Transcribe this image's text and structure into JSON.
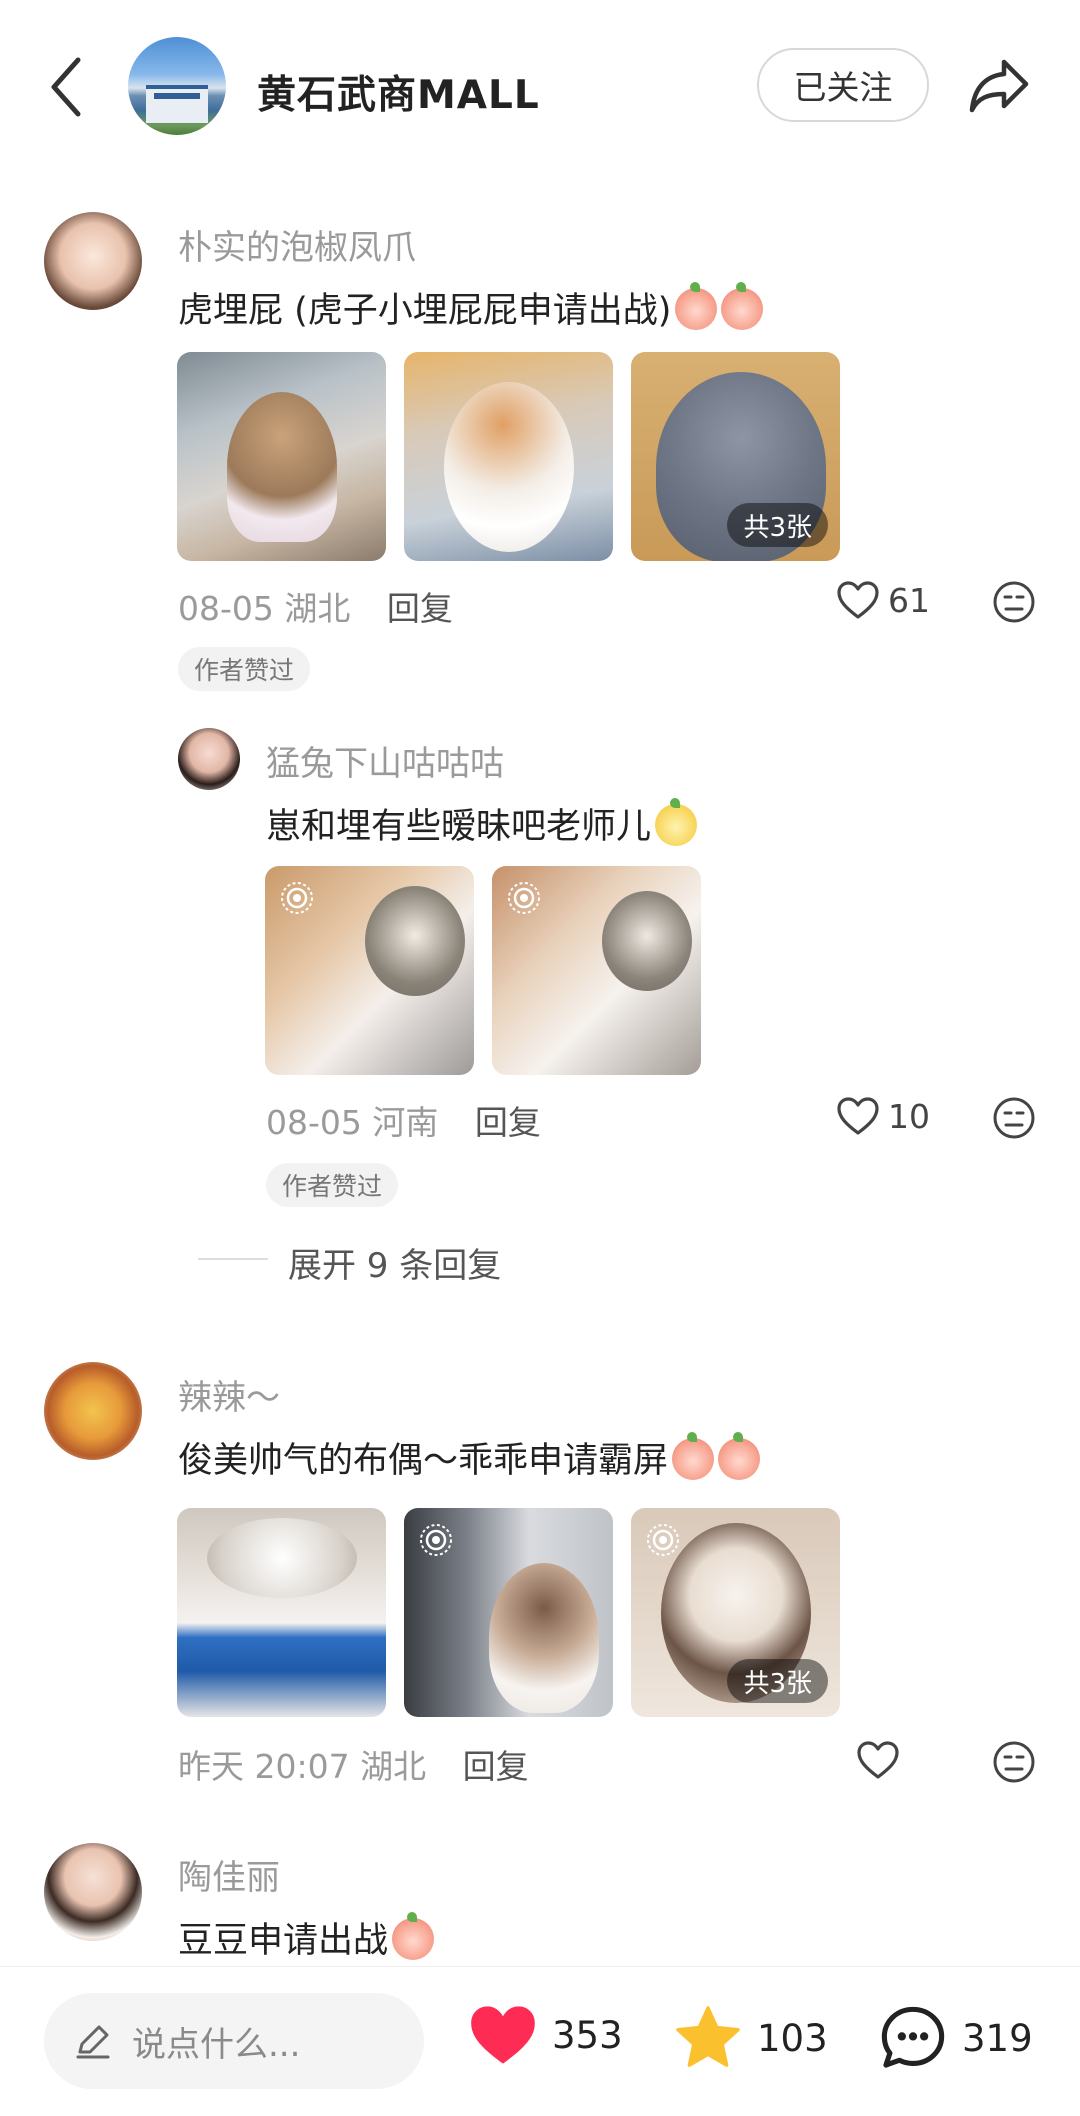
{
  "header": {
    "back_icon": "chevron-left-icon",
    "shop_name": "黄石武商MALL",
    "follow_label": "已关注",
    "share_icon": "share-arrow-icon"
  },
  "comments": [
    {
      "user": "朴实的泡椒凤爪",
      "text": "虎埋屁 (虎子小埋屁屁申请出战)",
      "emojis": [
        "peach-emoji",
        "peach-emoji"
      ],
      "images_more": "共3张",
      "date": "08-05",
      "location": "湖北",
      "reply_label": "回复",
      "likes": "61",
      "badge": "作者赞过",
      "replies": [
        {
          "user": "猛兔下山咕咕咕",
          "text": "崽和埋有些暧昧吧老师儿",
          "emojis": [
            "smug-emoji"
          ],
          "date": "08-05",
          "location": "河南",
          "reply_label": "回复",
          "likes": "10",
          "badge": "作者赞过"
        }
      ],
      "expand_label": "展开 9 条回复"
    },
    {
      "user": "辣辣～",
      "text": "俊美帅气的布偶～乖乖申请霸屏",
      "emojis": [
        "peach-emoji",
        "peach-emoji"
      ],
      "images_more": "共3张",
      "date": "昨天 20:07",
      "location": "湖北",
      "reply_label": "回复",
      "likes": ""
    },
    {
      "user": "陶佳丽",
      "text": "豆豆申请出战",
      "emojis": [
        "peach-emoji"
      ]
    }
  ],
  "bottom_bar": {
    "input_placeholder": "说点什么...",
    "likes": "353",
    "stars": "103",
    "comments": "319",
    "colors": {
      "heart": "#fe2c55",
      "star": "#fbc02d"
    }
  }
}
